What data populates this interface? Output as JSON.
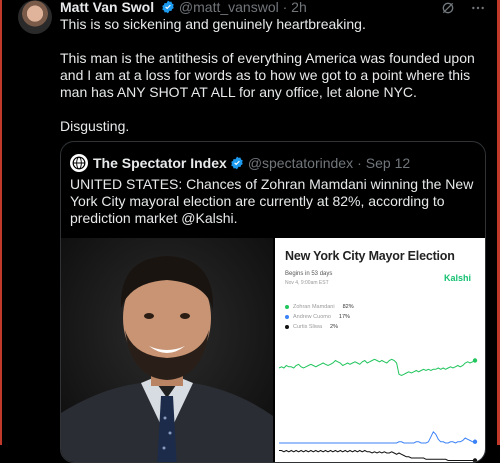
{
  "author": {
    "name": "Matt Van Swol",
    "handle": "@matt_vanswol",
    "time": "2h",
    "verified_color": "#1d9bf0"
  },
  "tweet": {
    "paragraphs": [
      "This is so sickening and genuinely heartbreaking.",
      "This man is the antithesis of everything America was founded upon and I am at a loss for words as to how we got to a point where this man has ANY SHOT AT ALL for any office, let alone NYC.",
      "Disgusting."
    ]
  },
  "quote": {
    "name": "The Spectator Index",
    "handle": "@spectatorindex",
    "date": "Sep 12",
    "text": "UNITED STATES: Chances of Zohran Mamdani winning the New York City mayoral election are currently at 82%, according to prediction market @Kalshi."
  },
  "chart_card": {
    "title": "New York City Mayor Election",
    "subtitle": "Begins in 53 days",
    "date_line": "Nov 4, 9:00am EST",
    "brand": "Kalshi",
    "brand_color": "#16c172"
  },
  "chart_data": {
    "type": "line",
    "title": "New York City Mayor Election",
    "ylim": [
      0,
      100
    ],
    "series": [
      {
        "name": "Zohran Mamdani",
        "label": "82%",
        "color": "#22c55e",
        "values": [
          76,
          77,
          76,
          78,
          77,
          77,
          76,
          78,
          79,
          77,
          76,
          77,
          78,
          79,
          78,
          77,
          78,
          79,
          80,
          79,
          78,
          79,
          80,
          82,
          81,
          80,
          78,
          79,
          80,
          79,
          80,
          81,
          80,
          79,
          81,
          82,
          80,
          81,
          82,
          83,
          82,
          81,
          82,
          81,
          80,
          82,
          83,
          82,
          80,
          71,
          70,
          71,
          72,
          73,
          72,
          73,
          74,
          73,
          74,
          75,
          74,
          75,
          74,
          75,
          75,
          76,
          75,
          76,
          75,
          76,
          77,
          76,
          77,
          78,
          77,
          78,
          80,
          81,
          80,
          81,
          82
        ]
      },
      {
        "name": "Andrew Cuomo",
        "label": "17%",
        "color": "#3b82f6",
        "values": [
          16,
          16,
          16,
          16,
          16,
          16,
          16,
          16,
          16,
          16,
          16,
          16,
          16,
          16,
          16,
          16,
          16,
          16,
          16,
          16,
          16,
          16,
          16,
          16,
          16,
          16,
          16,
          16,
          16,
          16,
          16,
          16,
          16,
          16,
          16,
          16,
          16,
          16,
          16,
          16,
          16,
          16,
          16,
          16,
          16,
          16,
          16,
          16,
          16,
          17,
          17,
          16,
          16,
          16,
          16,
          16,
          17,
          17,
          16,
          16,
          16,
          17,
          21,
          25,
          23,
          19,
          17,
          17,
          16,
          16,
          17,
          17,
          16,
          17,
          17,
          18,
          20,
          19,
          18,
          17,
          17
        ]
      },
      {
        "name": "Curtis Sliwa",
        "label": "2%",
        "color": "#111111",
        "values": [
          10,
          10,
          9,
          10,
          9,
          10,
          9,
          10,
          9,
          10,
          9,
          10,
          9,
          10,
          9,
          10,
          9,
          10,
          9,
          10,
          9,
          10,
          9,
          10,
          9,
          10,
          9,
          10,
          9,
          10,
          9,
          10,
          9,
          10,
          9,
          10,
          9,
          9,
          8,
          9,
          8,
          9,
          8,
          9,
          8,
          8,
          9,
          8,
          7,
          8,
          7,
          6,
          5,
          5,
          4,
          4,
          4,
          4,
          4,
          4,
          3,
          3,
          3,
          3,
          3,
          3,
          3,
          3,
          3,
          2,
          2,
          2,
          2,
          2,
          2,
          2,
          2,
          2,
          2,
          2,
          2
        ]
      }
    ]
  }
}
